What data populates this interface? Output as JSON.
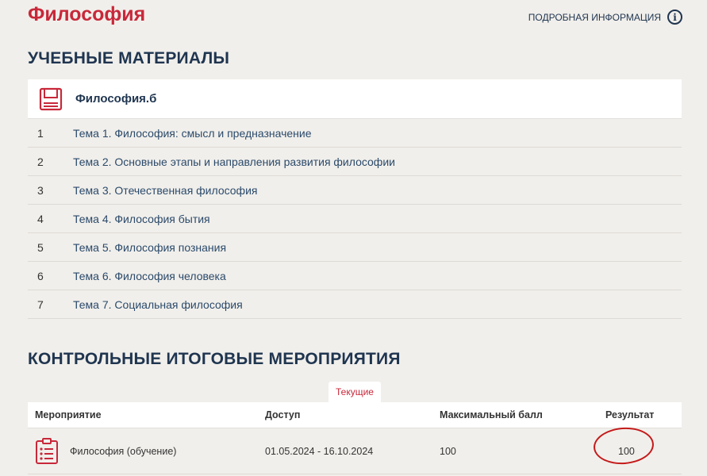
{
  "page": {
    "title": "Философия"
  },
  "header": {
    "info_label": "ПОДРОБНАЯ ИНФОРМАЦИЯ",
    "info_icon": "info-icon"
  },
  "materials": {
    "section_title": "УЧЕБНЫЕ МАТЕРИАЛЫ",
    "course_icon": "book-icon",
    "course_name": "Философия.б",
    "topics": [
      {
        "num": "1",
        "label": "Тема 1. Философия: смысл и предназначение"
      },
      {
        "num": "2",
        "label": "Тема 2. Основные этапы и направления развития философии"
      },
      {
        "num": "3",
        "label": "Тема 3. Отечественная философия"
      },
      {
        "num": "4",
        "label": "Тема 4. Философия бытия"
      },
      {
        "num": "5",
        "label": "Тема 5. Философия познания"
      },
      {
        "num": "6",
        "label": "Тема 6. Философия человека"
      },
      {
        "num": "7",
        "label": "Тема 7. Социальная философия"
      }
    ]
  },
  "events": {
    "section_title": "КОНТРОЛЬНЫЕ ИТОГОВЫЕ МЕРОПРИЯТИЯ",
    "tab_label": "Текущие",
    "columns": {
      "event": "Мероприятие",
      "access": "Доступ",
      "max_score": "Максимальный балл",
      "result": "Результат"
    },
    "rows": [
      {
        "icon": "clipboard-list-icon",
        "name": "Философия (обучение)",
        "access": "01.05.2024 - 16.10.2024",
        "max_score": "100",
        "result": "100"
      }
    ]
  },
  "colors": {
    "brand_red": "#c8283a",
    "navy": "#1f3550",
    "background": "#f1efeb",
    "annotation_red": "#c41a1a"
  }
}
